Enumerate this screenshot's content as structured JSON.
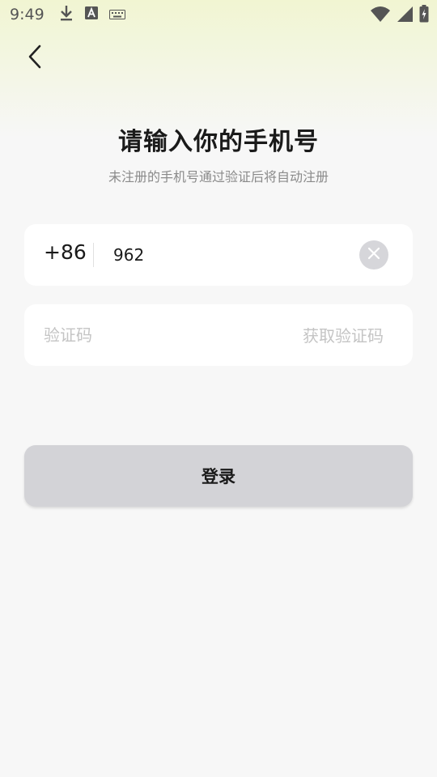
{
  "status_bar": {
    "time": "9:49",
    "left_icons": [
      "download-icon",
      "font-a-icon",
      "keyboard-icon"
    ],
    "right_icons": [
      "wifi-icon",
      "signal-icon",
      "battery-charging-icon"
    ]
  },
  "header": {
    "back_icon": "chevron-left-icon",
    "title": "请输入你的手机号",
    "subtitle": "未注册的手机号通过验证后将自动注册"
  },
  "phone_field": {
    "country_code": "+86",
    "value": "962",
    "clear_icon": "close-circle-icon"
  },
  "code_field": {
    "placeholder": "验证码",
    "get_code_label": "获取验证码"
  },
  "login_button": {
    "label": "登录"
  },
  "colors": {
    "background": "#f7f7f7",
    "top_tint": "#f1f5d2",
    "card": "#ffffff",
    "button_disabled": "#d3d3d7",
    "placeholder": "#c4c4c4"
  }
}
